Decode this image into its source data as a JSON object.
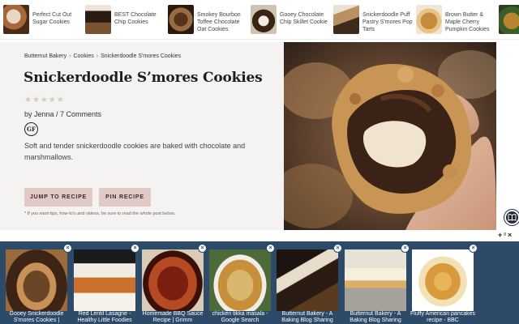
{
  "top_strip": [
    {
      "label": "Perfect Cut Out Sugar Cookies",
      "thumb": "thumb-a"
    },
    {
      "label": "BEST Chocolate Chip Cookies",
      "thumb": "thumb-b"
    },
    {
      "label": "Smokey Bourbon Toffee Chocolate Oat Cookies",
      "thumb": "thumb-c"
    },
    {
      "label": "Gooey Chocolate Chip Skillet Cookie",
      "thumb": "thumb-d"
    },
    {
      "label": "Snickerdoodle Puff Pastry S'mores Pop Tarts",
      "thumb": "thumb-e"
    },
    {
      "label": "Brown Butter & Maple Cherry Pumpkin Cookies",
      "thumb": "thumb-f"
    }
  ],
  "breadcrumb": [
    "Butternut Bakery",
    "Cookies",
    "Snickerdoodle S'mores Cookies"
  ],
  "breadcrumb_sep": "›",
  "title": "Snickerdoodle S’mores Cookies",
  "stars": "★★★★★",
  "byline": "by Jenna / 7 Comments",
  "badge": "GF",
  "description": "Soft and tender snickerdoodle cookies are baked with chocolate and marshmallows.",
  "buttons": {
    "jump": "JUMP TO RECIPE",
    "pin": "PIN RECIPE"
  },
  "footnote": "* If you want tips, how-to's and videos, be sure to read the whole post below.",
  "controls": {
    "plus": "+",
    "sub": "8",
    "close": "×"
  },
  "related": [
    {
      "label": "Gooey Snickerdoodle S'mores Cookies |",
      "thumb": "r1"
    },
    {
      "label": "Red Lentil Lasagne - Healthy Little Foodies",
      "thumb": "r2"
    },
    {
      "label": "Homemade BBQ Sauce Recipe | Grimm",
      "thumb": "r3"
    },
    {
      "label": "chicken tikka masala - Google Search",
      "thumb": "r4"
    },
    {
      "label": "Butternut Bakery - A Baking Blog Sharing",
      "thumb": "r5"
    },
    {
      "label": "Butternut Bakery - A Baking Blog Sharing",
      "thumb": "r6"
    },
    {
      "label": "Fluffy American pancakes recipe - BBC",
      "thumb": "r7"
    }
  ],
  "related_close": "×",
  "colors": {
    "bottom_bar": "#2d4a69",
    "button": "#e2c9c6",
    "card": "#f5f3f1"
  }
}
